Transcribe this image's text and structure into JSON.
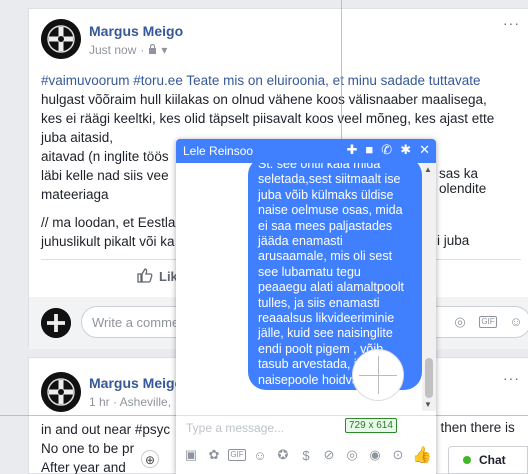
{
  "post1": {
    "author": "Margus Meigo",
    "time": "Just now",
    "text_lines": [
      "#vaimuvoorum #toru.ee Teate mis on eluiroonia, et minu sadade tuttavate",
      "hulgast võõraim hull kiilakas on olnud vähene koos välisnaaber maalisega,",
      "kes ei räägi keeltki, kes olid täpselt piisavalt koos veel mõneg, kes ajast ette",
      "juba aitasid,",
      "aitavad (n inglite töös",
      "läbi kelle nad siis vee",
      "mateeriaga",
      "// ma loodan, et Eestla",
      "juhuslikult pikalt või ka"
    ],
    "text_right_fragments": [
      "sas ka olendite",
      "i juba"
    ],
    "like_label": "Lik",
    "comment_placeholder": "Write a comme"
  },
  "post2": {
    "author": "Margus Meigo",
    "time": "1 hr · Asheville,",
    "text_lines": [
      "in and out near #psyc",
      "No one to be pr",
      "After year and"
    ],
    "text_right_fragment": "; then there is"
  },
  "chat": {
    "title": "Lele Reinsoo",
    "message": "St. see ontli kala mida seletada,sest siitmaalt ise juba võib külmaks üldise naise oelmuse osas, mida ei saa mees paljastades jääda enamasti arusaamale, mis oli sest see lubamatu tegu peaaegu alati alamaltpoolt tulles, ja siis enamasti reaaalsus likvideeriminie jälle, kuid see naisinglite endi poolt pigem , võib tasub arvestada, ilm naisepoole hoidva",
    "input_placeholder": "Type a message..."
  },
  "overlay": {
    "dimensions": "729 x 614"
  },
  "chat_tab": {
    "label": "Chat"
  },
  "colors": {
    "accent": "#4080ff",
    "link": "#365899",
    "online": "#42b72a"
  }
}
